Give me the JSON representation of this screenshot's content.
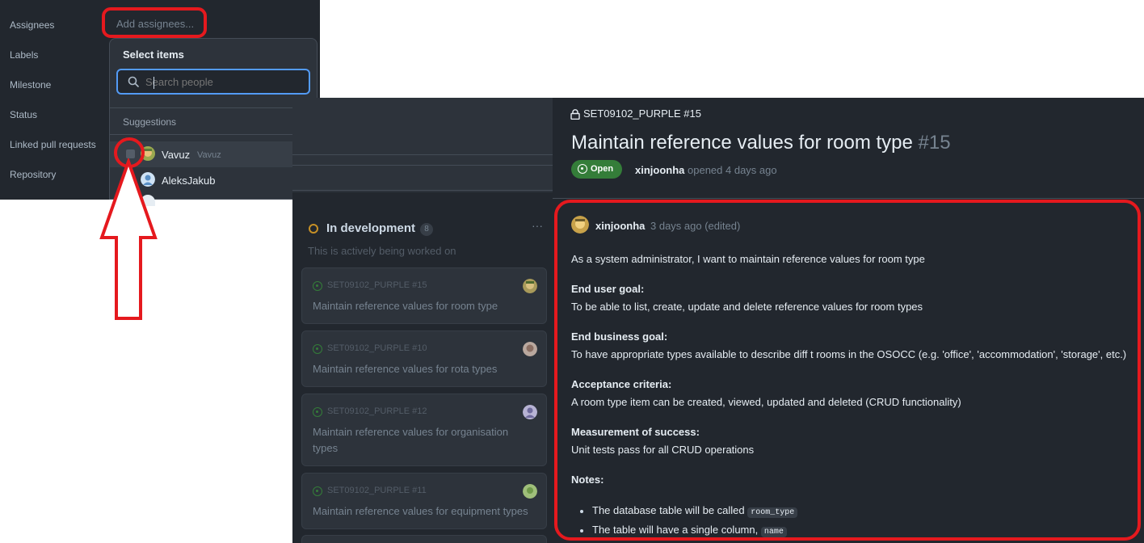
{
  "sidebar": {
    "labels": [
      "Assignees",
      "Labels",
      "Milestone",
      "Status",
      "Linked pull requests",
      "Repository"
    ],
    "add_assignees": "Add assignees..."
  },
  "assignee_dropdown": {
    "title": "Select items",
    "search_placeholder": "Search people",
    "suggestions_header": "Suggestions",
    "people": [
      {
        "name": "Vavuz",
        "handle": "Vavuz"
      },
      {
        "name": "AleksJakub",
        "handle": ""
      }
    ]
  },
  "board": {
    "column": {
      "title": "In development",
      "count": "8",
      "more": "···",
      "description": "This is actively being worked on"
    },
    "cards": [
      {
        "ref": "SET09102_PURPLE #15",
        "title": "Maintain reference values for room type"
      },
      {
        "ref": "SET09102_PURPLE #10",
        "title": "Maintain reference values for rota types"
      },
      {
        "ref": "SET09102_PURPLE #12",
        "title": "Maintain reference values for organisation types"
      },
      {
        "ref": "SET09102_PURPLE #11",
        "title": "Maintain reference values for equipment types"
      }
    ]
  },
  "issue": {
    "repo_ref": "SET09102_PURPLE #15",
    "title": "Maintain reference values for room type",
    "number": "#15",
    "state": "Open",
    "opened_by": "xinjoonha",
    "opened_text": "opened 4 days ago",
    "comment": {
      "author": "xinjoonha",
      "time": "3 days ago (edited)",
      "intro": "As a system administrator, I want to maintain reference values for room type",
      "end_user_goal_heading": "End user goal:",
      "end_user_goal": "To be able to list, create, update and delete reference values for room types",
      "end_business_goal_heading": "End business goal:",
      "end_business_goal": "To have appropriate types available to describe diff t rooms in the OSOCC (e.g. 'office', 'accommodation', 'storage', etc.)",
      "acceptance_heading": "Acceptance criteria:",
      "acceptance": "A room type item can be created, viewed, updated and deleted (CRUD functionality)",
      "measurement_heading": "Measurement of success:",
      "measurement": "Unit tests pass for all CRUD operations",
      "notes_heading": "Notes:",
      "notes": [
        {
          "text": "The database table will be called",
          "code": "room_type"
        },
        {
          "text": "The table will have a single column,",
          "code": "name"
        }
      ]
    }
  },
  "colors": {
    "highlight": "#e5191e",
    "open_green": "#347d39",
    "panel_bg": "#22272e",
    "focus_blue": "#539bf5"
  }
}
